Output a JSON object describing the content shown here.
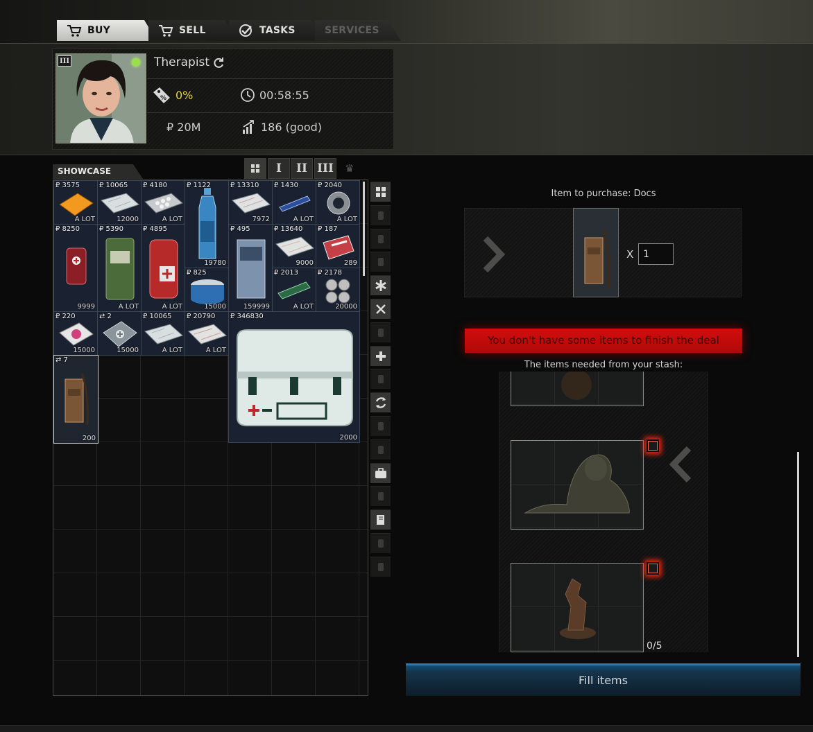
{
  "tabs": [
    {
      "label": "BUY",
      "icon": "cart-icon",
      "active": true
    },
    {
      "label": "SELL",
      "icon": "cart-icon"
    },
    {
      "label": "TASKS",
      "icon": "checkmark-icon"
    },
    {
      "label": "SERVICES",
      "disabled": true
    }
  ],
  "trader": {
    "name": "Therapist",
    "loyalty_level": "III",
    "discount": "0%",
    "timer": "00:58:55",
    "money": "₽ 20M",
    "standing": "186 (good)",
    "online": true
  },
  "showcase": {
    "title": "SHOWCASE",
    "level_filters": [
      "I",
      "II",
      "III"
    ],
    "items": [
      {
        "price": "₽ 3575",
        "stock": "A LOT",
        "name": "orange-folder"
      },
      {
        "price": "₽ 10065",
        "stock": "12000",
        "name": "map"
      },
      {
        "price": "₽ 4180",
        "stock": "A LOT",
        "name": "pill-blister"
      },
      {
        "price": "₽ 1122",
        "stock": "19780",
        "name": "water-bottle"
      },
      {
        "price": "₽ 13310",
        "stock": "7972",
        "name": "map"
      },
      {
        "price": "₽ 1430",
        "stock": "A LOT",
        "name": "injector"
      },
      {
        "price": "₽ 2040",
        "stock": "A LOT",
        "name": "tape-roll"
      },
      {
        "price": "₽ 8250",
        "stock": "9999",
        "name": "red-medkit"
      },
      {
        "price": "₽ 5390",
        "stock": "A LOT",
        "name": "army-bandage"
      },
      {
        "price": "₽ 4895",
        "stock": "A LOT",
        "name": "red-pouch"
      },
      {
        "price": "₽ 825",
        "stock": "15000",
        "name": "tin-can"
      },
      {
        "price": "₽ 495",
        "stock": "159999",
        "name": "ration-pack"
      },
      {
        "price": "₽ 13640",
        "stock": "9000",
        "name": "map"
      },
      {
        "price": "₽ 187",
        "stock": "289",
        "name": "snack-bag"
      },
      {
        "price": "₽ 2013",
        "stock": "A LOT",
        "name": "green-syringe"
      },
      {
        "price": "₽ 2178",
        "stock": "20000",
        "name": "pill-pack"
      },
      {
        "price": "₽ 220",
        "stock": "15000",
        "name": "juice-box"
      },
      {
        "price": "⇄ 2",
        "stock": "15000",
        "name": "grey-medkit"
      },
      {
        "price": "₽ 10065",
        "stock": "A LOT",
        "name": "map"
      },
      {
        "price": "₽ 20790",
        "stock": "A LOT",
        "name": "map"
      },
      {
        "price": "₽ 346830",
        "stock": "2000",
        "name": "medical-case"
      },
      {
        "price": "⇄ 7",
        "stock": "200",
        "name": "docs-case"
      }
    ]
  },
  "categories": [
    {
      "icon": "grid-icon",
      "active": true
    },
    {
      "icon": "rifle-icon"
    },
    {
      "icon": "magazine-icon"
    },
    {
      "icon": "ammo-icon"
    },
    {
      "icon": "medical-cross-icon",
      "active": true
    },
    {
      "icon": "fork-knife-icon",
      "active": true
    },
    {
      "icon": "knife-icon"
    },
    {
      "icon": "plus-icon",
      "active": true
    },
    {
      "icon": "grenade-icon"
    },
    {
      "icon": "barter-icon",
      "active": true
    },
    {
      "icon": "vest-icon"
    },
    {
      "icon": "backpack-icon"
    },
    {
      "icon": "briefcase-icon",
      "active": true
    },
    {
      "icon": "armor-icon"
    },
    {
      "icon": "book-icon",
      "active": true
    },
    {
      "icon": "key-icon"
    },
    {
      "icon": "info-icon"
    }
  ],
  "purchase": {
    "label": "Item to purchase: Docs",
    "quantity_prefix": "X",
    "quantity": "1"
  },
  "error_message": "You don't have some items to finish the deal",
  "needed_label": "The items needed from your stash:",
  "needed_count": "0/5",
  "fill_button": "Fill items"
}
